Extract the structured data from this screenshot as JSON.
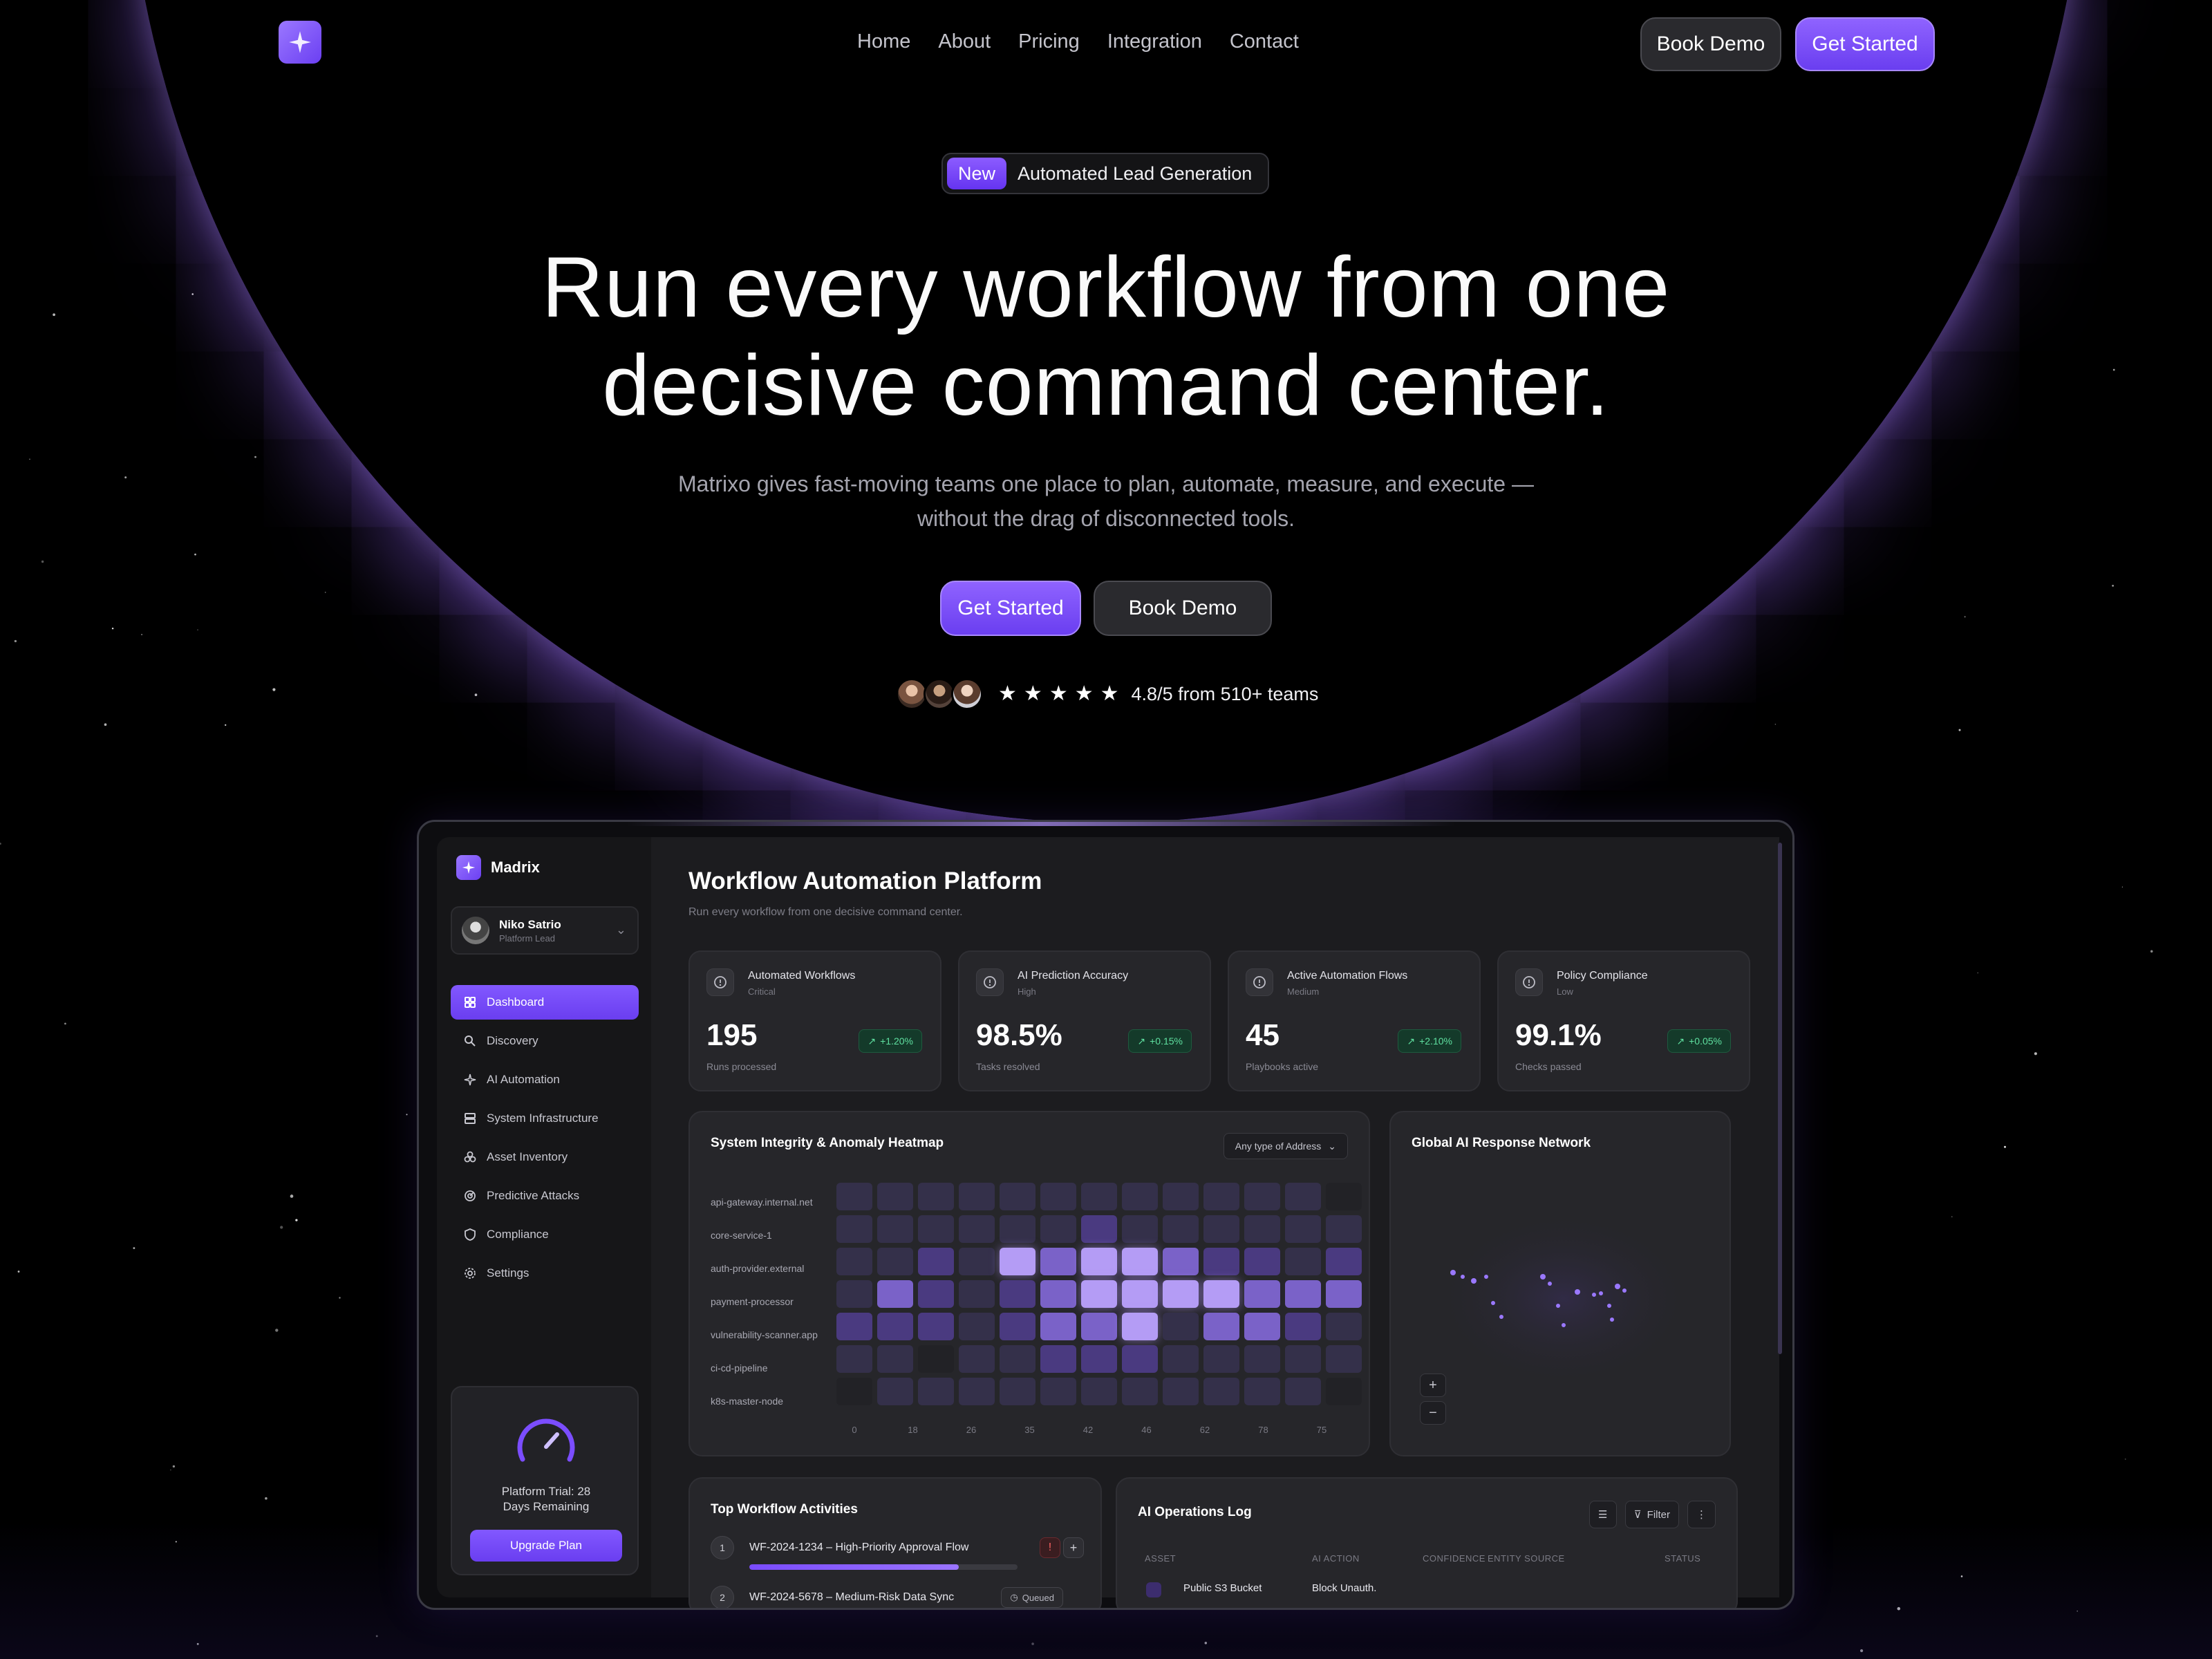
{
  "nav": {
    "links": [
      "Home",
      "About",
      "Pricing",
      "Integration",
      "Contact"
    ],
    "book_demo": "Book Demo",
    "get_started": "Get Started"
  },
  "hero": {
    "badge_new": "New",
    "badge_text": "Automated Lead Generation",
    "title_line1": "Run every workflow from one",
    "title_line2": "decisive command center.",
    "subtitle_line1": "Matrixo gives fast-moving teams one place to plan, automate, measure, and execute —",
    "subtitle_line2": "without the drag of disconnected tools.",
    "cta_primary": "Get Started",
    "cta_secondary": "Book Demo",
    "rating_text": "4.8/5 from 510+ teams",
    "rating_stars": 5
  },
  "dashboard": {
    "brand": "Madrix",
    "user": {
      "name": "Niko Satrio",
      "role": "Platform Lead"
    },
    "sidebar": [
      {
        "label": "Dashboard",
        "icon": "grid-icon",
        "active": true
      },
      {
        "label": "Discovery",
        "icon": "search-icon"
      },
      {
        "label": "AI Automation",
        "icon": "sparkle-icon"
      },
      {
        "label": "System Infrastructure",
        "icon": "server-icon"
      },
      {
        "label": "Asset Inventory",
        "icon": "cubes-icon"
      },
      {
        "label": "Predictive Attacks",
        "icon": "radar-icon"
      },
      {
        "label": "Compliance",
        "icon": "shield-icon"
      },
      {
        "label": "Settings",
        "icon": "gear-icon"
      }
    ],
    "trial": {
      "line1": "Platform Trial: 28",
      "line2": "Days Remaining",
      "button": "Upgrade Plan"
    },
    "title": "Workflow Automation Platform",
    "subtitle": "Run every workflow from one decisive command center.",
    "stats": [
      {
        "label": "Automated Workflows",
        "level": "Critical",
        "value": "195",
        "foot": "Runs processed",
        "change": "+1.20%"
      },
      {
        "label": "AI Prediction Accuracy",
        "level": "High",
        "value": "98.5%",
        "foot": "Tasks resolved",
        "change": "+0.15%"
      },
      {
        "label": "Active Automation Flows",
        "level": "Medium",
        "value": "45",
        "foot": "Playbooks active",
        "change": "+2.10%"
      },
      {
        "label": "Policy Compliance",
        "level": "Low",
        "value": "99.1%",
        "foot": "Checks passed",
        "change": "+0.05%"
      }
    ],
    "heatmap": {
      "title": "System Integrity & Anomaly Heatmap",
      "dropdown": "Any type of Address",
      "rows": [
        "api-gateway.internal.net",
        "core-service-1",
        "auth-provider.external",
        "payment-processor",
        "vulnerability-scanner.app",
        "ci-cd-pipeline",
        "k8s-master-node"
      ],
      "x_ticks": [
        "0",
        "18",
        "26",
        "35",
        "42",
        "46",
        "62",
        "78",
        "75"
      ],
      "levels": [
        [
          1,
          1,
          1,
          1,
          1,
          1,
          1,
          1,
          1,
          1,
          1,
          1,
          0
        ],
        [
          1,
          1,
          1,
          1,
          1,
          1,
          2,
          1,
          1,
          1,
          1,
          1,
          1
        ],
        [
          1,
          1,
          2,
          1,
          4,
          3,
          4,
          4,
          3,
          2,
          2,
          1,
          2
        ],
        [
          1,
          3,
          2,
          1,
          2,
          3,
          4,
          4,
          4,
          4,
          3,
          3,
          3
        ],
        [
          2,
          2,
          2,
          1,
          2,
          3,
          3,
          4,
          1,
          3,
          3,
          2,
          1
        ],
        [
          1,
          1,
          0,
          1,
          1,
          2,
          2,
          2,
          1,
          1,
          1,
          1,
          1
        ],
        [
          0,
          1,
          1,
          1,
          1,
          1,
          1,
          1,
          1,
          1,
          1,
          1,
          0
        ]
      ],
      "colors": [
        "#222226",
        "#34304a",
        "#4a3a80",
        "#7a62c8",
        "#b49cf5"
      ]
    },
    "network": {
      "title": "Global AI Response Network",
      "zoom_in": "+",
      "zoom_out": "−"
    },
    "activities": {
      "title": "Top Workflow Activities",
      "items": [
        {
          "num": "1",
          "name": "WF-2024-1234 – High-Priority Approval Flow",
          "progress": 0.78
        },
        {
          "num": "2",
          "name": "WF-2024-5678 – Medium-Risk Data Sync",
          "status": "Queued"
        }
      ]
    },
    "oplog": {
      "title": "AI Operations Log",
      "filter": "Filter",
      "columns": [
        "ASSET",
        "AI ACTION",
        "CONFIDENCE",
        "ENTITY SOURCE",
        "STATUS"
      ],
      "row": {
        "asset": "Public S3 Bucket",
        "action": "Block Unauth."
      }
    }
  }
}
